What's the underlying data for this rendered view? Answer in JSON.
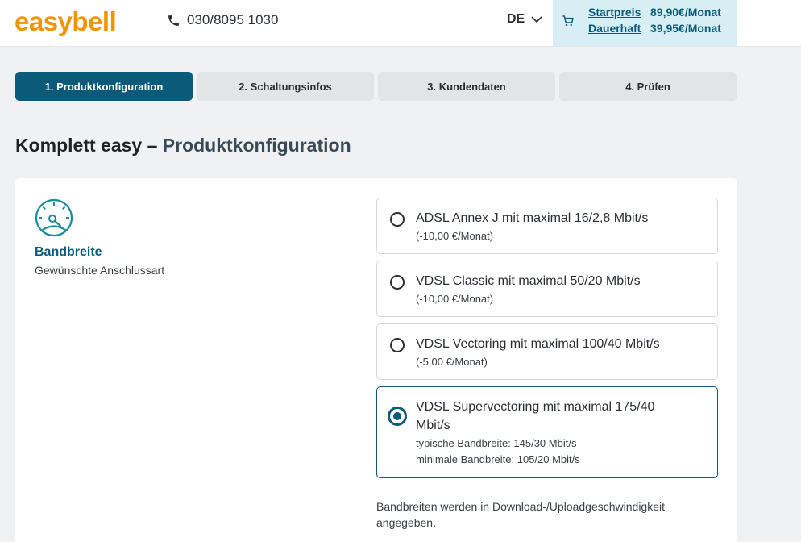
{
  "header": {
    "logo_text": "easybell",
    "phone": "030/8095 1030",
    "language": "DE",
    "cart": {
      "start_label": "Startpreis",
      "start_price": "89,90€/Monat",
      "permanent_label": "Dauerhaft",
      "permanent_price": "39,95€/Monat"
    }
  },
  "steps": [
    {
      "label": "1. Produktkonfiguration",
      "active": true
    },
    {
      "label": "2. Schaltungsinfos",
      "active": false
    },
    {
      "label": "3. Kundendaten",
      "active": false
    },
    {
      "label": "4. Prüfen",
      "active": false
    }
  ],
  "page": {
    "title_main": "Komplett easy",
    "title_sep": " – ",
    "title_sub": "Produktkonfiguration"
  },
  "section": {
    "icon": "speedometer-icon",
    "title": "Bandbreite",
    "subtitle": "Gewünschte Anschlussart"
  },
  "options": [
    {
      "title": "ADSL Annex J mit maximal 16/2,8 Mbit/s",
      "sub1": "(-10,00 €/Monat)",
      "sub2": "",
      "selected": false
    },
    {
      "title": "VDSL Classic mit maximal 50/20 Mbit/s",
      "sub1": "(-10,00 €/Monat)",
      "sub2": "",
      "selected": false
    },
    {
      "title": "VDSL Vectoring mit maximal 100/40 Mbit/s",
      "sub1": "(-5,00 €/Monat)",
      "sub2": "",
      "selected": false
    },
    {
      "title": "VDSL Supervectoring mit maximal 175/40 Mbit/s",
      "sub1": "typische Bandbreite: 145/30 Mbit/s",
      "sub2": "minimale Bandbreite: 105/20 Mbit/s",
      "selected": true
    }
  ],
  "note": "Bandbreiten werden in Download-/Uploadgeschwindigkeit angegeben.",
  "colors": {
    "brand_orange": "#f29400",
    "accent_blue": "#0b5a7a",
    "cart_bg": "#d7eef4",
    "speedometer_teal": "#1b8a9a"
  }
}
